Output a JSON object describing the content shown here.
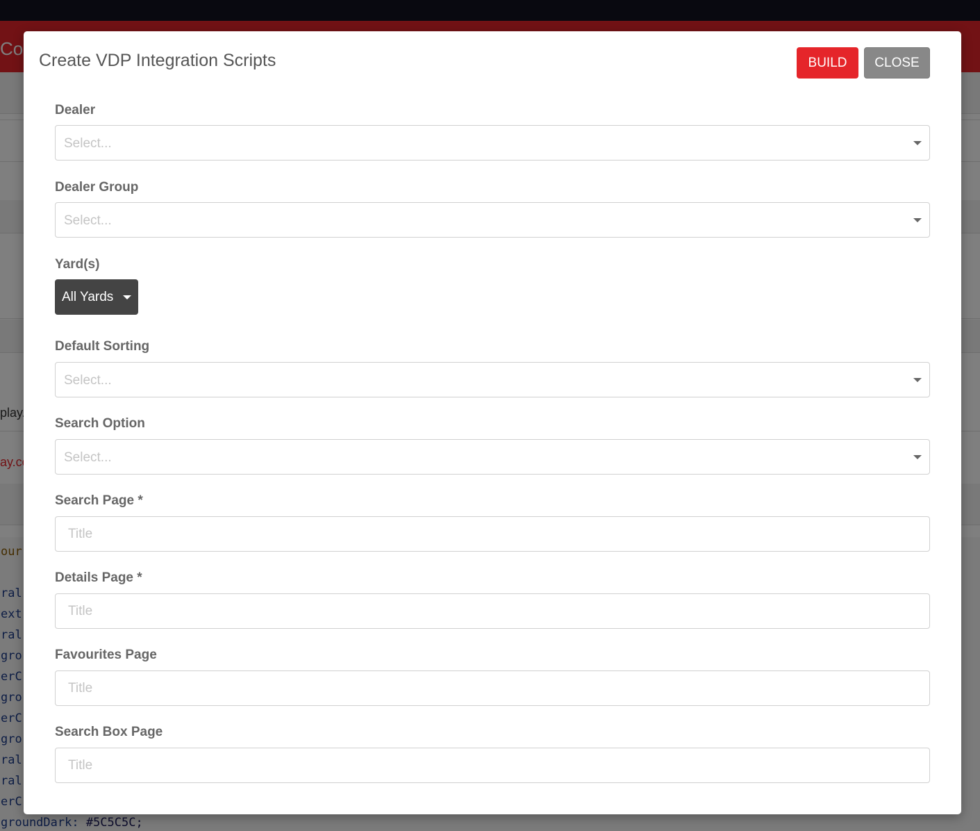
{
  "background": {
    "header_text": "Co",
    "snippet_1": "play.",
    "snippet_2": "ay.co",
    "code_lines": [
      "our",
      "ral",
      "ext",
      "ral",
      "gro",
      "erC",
      "gro",
      "erC",
      "gro",
      "ral",
      "ral",
      "erC"
    ],
    "code_last_key": "groundDark: ",
    "code_last_value": "#5C5C5C;"
  },
  "modal": {
    "title": "Create VDP Integration Scripts",
    "build_label": "BUILD",
    "close_label": "CLOSE",
    "fields": {
      "dealer": {
        "label": "Dealer",
        "placeholder": "Select..."
      },
      "dealer_group": {
        "label": "Dealer Group",
        "placeholder": "Select..."
      },
      "yards": {
        "label": "Yard(s)",
        "value": "All Yards"
      },
      "default_sorting": {
        "label": "Default Sorting",
        "placeholder": "Select..."
      },
      "search_option": {
        "label": "Search Option",
        "placeholder": "Select..."
      },
      "search_page": {
        "label": "Search Page *",
        "placeholder": "Title"
      },
      "details_page": {
        "label": "Details Page *",
        "placeholder": "Title"
      },
      "favourites_page": {
        "label": "Favourites Page",
        "placeholder": "Title"
      },
      "search_box_page": {
        "label": "Search Box Page",
        "placeholder": "Title"
      }
    }
  },
  "colors": {
    "accent": "#e5252a",
    "close_button": "#888888",
    "yards_button": "#444444",
    "topbar": "#121220"
  }
}
